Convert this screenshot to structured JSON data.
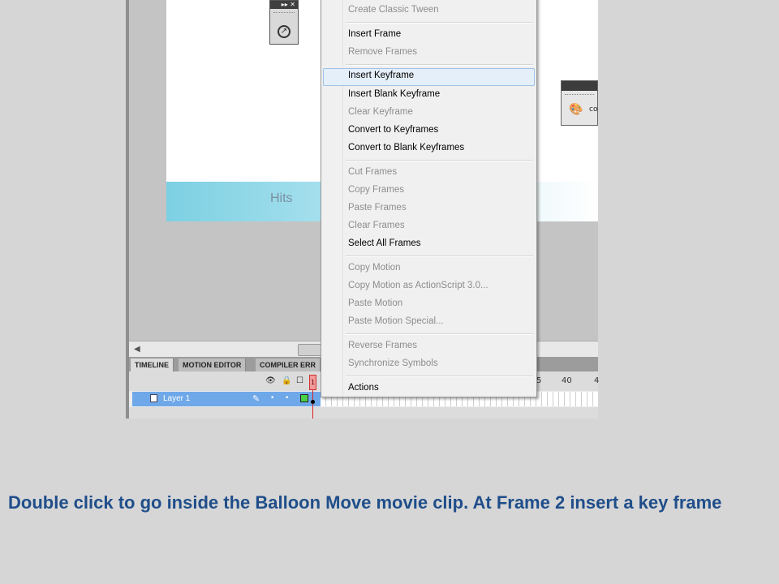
{
  "stage": {
    "banner_text": "Hits"
  },
  "tool_panel": {
    "header_glyphs": "▸▸ ✕",
    "tool_glyph": "↗"
  },
  "right_panel": {
    "label": "co"
  },
  "timeline": {
    "tabs": [
      "TIMELINE",
      "MOTION EDITOR",
      "COMPILER ERR"
    ],
    "ruler_labels": [
      "1",
      "5",
      "40",
      "4"
    ],
    "layer_name": "Layer 1"
  },
  "context_menu": {
    "items": [
      {
        "label": "Create Classic Tween",
        "enabled": false
      },
      {
        "label": "Insert Frame",
        "enabled": true
      },
      {
        "label": "Remove Frames",
        "enabled": false
      },
      {
        "label": "Insert Keyframe",
        "enabled": true,
        "highlighted": true
      },
      {
        "label": "Insert Blank Keyframe",
        "enabled": true
      },
      {
        "label": "Clear Keyframe",
        "enabled": false
      },
      {
        "label": "Convert to Keyframes",
        "enabled": true
      },
      {
        "label": "Convert to Blank Keyframes",
        "enabled": true
      },
      {
        "label": "Cut Frames",
        "enabled": false
      },
      {
        "label": "Copy Frames",
        "enabled": false
      },
      {
        "label": "Paste Frames",
        "enabled": false
      },
      {
        "label": "Clear Frames",
        "enabled": false
      },
      {
        "label": "Select All Frames",
        "enabled": true
      },
      {
        "label": "Copy Motion",
        "enabled": false
      },
      {
        "label": "Copy Motion as ActionScript 3.0...",
        "enabled": false
      },
      {
        "label": "Paste Motion",
        "enabled": false
      },
      {
        "label": "Paste Motion Special...",
        "enabled": false
      },
      {
        "label": "Reverse Frames",
        "enabled": false
      },
      {
        "label": "Synchronize Symbols",
        "enabled": false
      },
      {
        "label": "Actions",
        "enabled": true
      }
    ]
  },
  "caption": "Double click to go inside the Balloon Move movie clip. At Frame 2 insert a key frame"
}
